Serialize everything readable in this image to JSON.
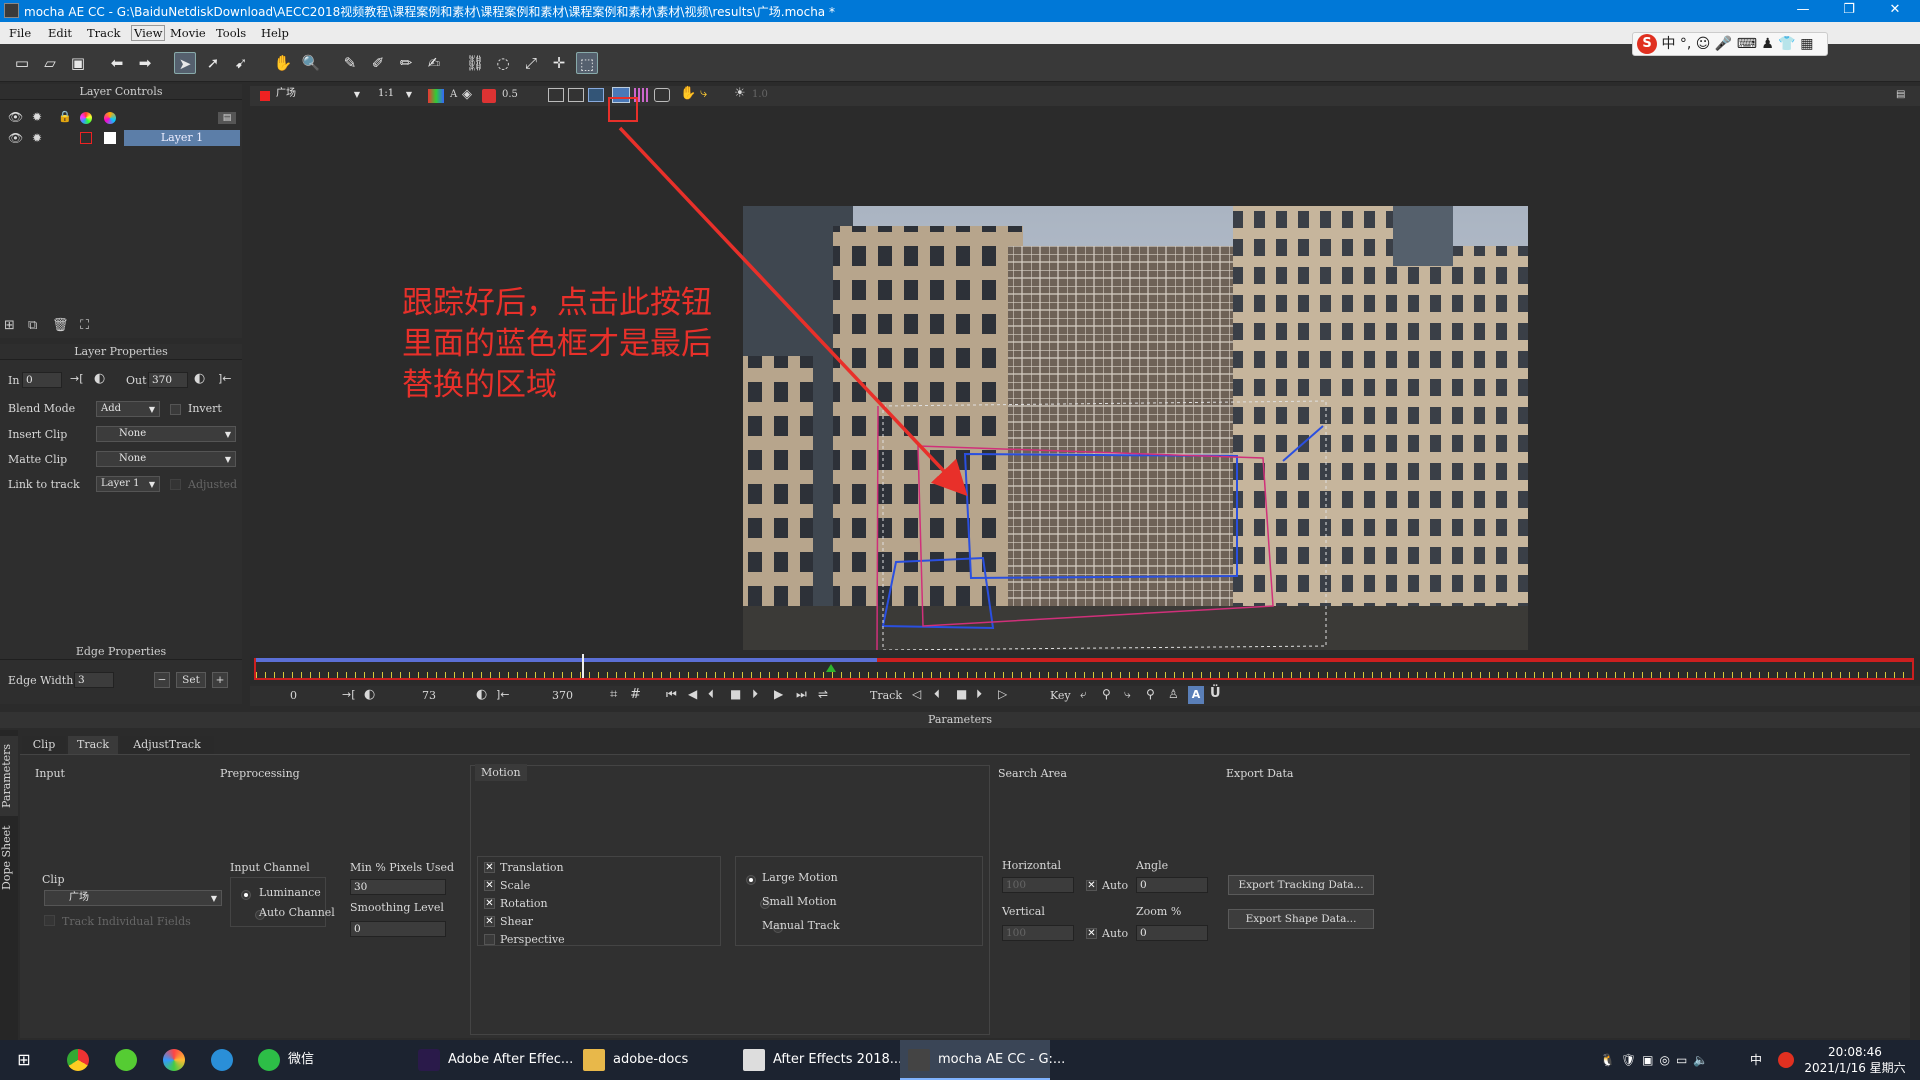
{
  "window": {
    "title": "mocha AE CC - G:\\BaiduNetdiskDownload\\AECC2018视频教程\\课程案例和素材\\课程案例和素材\\课程案例和素材\\素材\\视频\\results\\广场.mocha *",
    "minimize": "—",
    "restore": "❐",
    "close": "✕"
  },
  "menu": [
    "File",
    "Edit",
    "Track",
    "View",
    "Movie",
    "Tools",
    "Help"
  ],
  "ime": {
    "logo": "S",
    "text": "中 °, ☺ 🎤 ⌨ ♟ 👕 ▦"
  },
  "viewer_bar": {
    "clip": "广场",
    "zoom": "1:1",
    "opacity": "0.5",
    "alpha": "A",
    "gamma": "1.0"
  },
  "layer_controls": {
    "title": "Layer Controls",
    "layer_name": "Layer 1"
  },
  "layer_properties": {
    "title": "Layer Properties",
    "in_label": "In",
    "in_value": "0",
    "out_label": "Out",
    "out_value": "370",
    "blend_mode_label": "Blend Mode",
    "blend_mode_value": "Add",
    "invert_label": "Invert",
    "insert_clip_label": "Insert Clip",
    "insert_clip_value": "None",
    "matte_clip_label": "Matte Clip",
    "matte_clip_value": "None",
    "link_to_track_label": "Link to track",
    "link_to_track_value": "Layer 1",
    "adjusted_label": "Adjusted"
  },
  "edge_properties": {
    "title": "Edge Properties",
    "edge_width_label": "Edge Width",
    "edge_width_value": "3",
    "minus": "−",
    "set": "Set",
    "plus": "+"
  },
  "annotation": {
    "line1": "跟踪好后，点击此按钮",
    "line2": "里面的蓝色框才是最后",
    "line3": "替换的区域"
  },
  "timeline": {
    "start": "0",
    "current": "73",
    "end": "370",
    "track_label": "Track",
    "key_label": "Key",
    "playhead_fraction": 0.197,
    "in_marker_fraction": 0.347
  },
  "parameters": {
    "title": "Parameters",
    "side_tabs": [
      "Parameters",
      "Dope Sheet"
    ],
    "tabs": [
      "Clip",
      "Track",
      "AdjustTrack"
    ],
    "input": {
      "title": "Input",
      "clip_label": "Clip",
      "clip_value": "广场",
      "track_fields": "Track Individual Fields"
    },
    "preprocessing": {
      "title": "Preprocessing",
      "input_channel": "Input Channel",
      "luminance": "Luminance",
      "auto_channel": "Auto Channel",
      "min_pixels_label": "Min % Pixels Used",
      "min_pixels_value": "30",
      "smoothing_label": "Smoothing Level",
      "smoothing_value": "0"
    },
    "motion": {
      "title": "Motion",
      "translation": "Translation",
      "scale": "Scale",
      "rotation": "Rotation",
      "shear": "Shear",
      "perspective": "Perspective",
      "large_motion": "Large Motion",
      "small_motion": "Small Motion",
      "manual_track": "Manual Track"
    },
    "search_area": {
      "title": "Search Area",
      "horizontal": "Horizontal",
      "horizontal_value": "100",
      "vertical": "Vertical",
      "vertical_value": "100",
      "auto": "Auto",
      "angle": "Angle",
      "angle_value": "0",
      "zoom": "Zoom %",
      "zoom_value": "0"
    },
    "export_data": {
      "title": "Export Data",
      "export_tracking": "Export Tracking Data...",
      "export_shape": "Export Shape Data..."
    }
  },
  "taskbar": {
    "apps": [
      "微信",
      "Adobe After Effec...",
      "adobe-docs",
      "After Effects 2018...",
      "mocha AE CC - G:..."
    ],
    "time": "20:08:46",
    "date": "2021/1/16 星期六",
    "tray_lang": "中"
  },
  "colors": {
    "accent": "#0078d7",
    "annotation": "#e8302a",
    "track_red": "#cc1f1f",
    "track_blue": "#5b6fd6"
  }
}
